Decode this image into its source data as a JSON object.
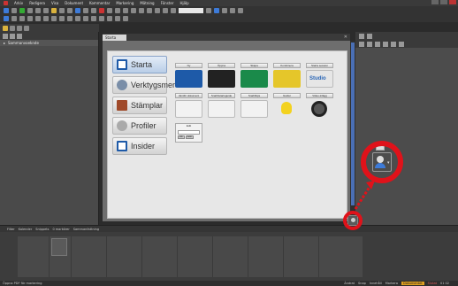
{
  "menubar": {
    "items": [
      "Arkiv",
      "Redigera",
      "Visa",
      "Dokument",
      "Kommentar",
      "Markering",
      "Mätning",
      "Fönster",
      "Hjälp"
    ]
  },
  "left_panel": {
    "title": "Sammanvoeknde"
  },
  "document_tab": {
    "label": "Starta",
    "close": "✕"
  },
  "start_menu": {
    "items": [
      {
        "label": "Starta",
        "icon": "start-icon",
        "active": true
      },
      {
        "label": "Verktygsmer",
        "icon": "tools-icon",
        "active": false
      },
      {
        "label": "Stämplar",
        "icon": "stamp-icon",
        "active": false
      },
      {
        "label": "Profiler",
        "icon": "profile-icon",
        "active": false
      },
      {
        "label": "Insider",
        "icon": "insider-icon",
        "active": false
      }
    ]
  },
  "tiles": [
    {
      "label": "Ny",
      "style": "blue"
    },
    {
      "label": "Öppna",
      "style": "dark"
    },
    {
      "label": "Skapa",
      "style": "green"
    },
    {
      "label": "Kombinera",
      "style": "yellow"
    },
    {
      "label": "Starta session",
      "style": "studio",
      "text": "Studio"
    },
    {
      "label": "Jämför dokument",
      "style": "paper"
    },
    {
      "label": "Snabbstartsguide",
      "style": "paper"
    },
    {
      "label": "Snabbtips",
      "style": "paper"
    },
    {
      "label": "Guider",
      "style": "bulb"
    },
    {
      "label": "Video-inlägg",
      "style": "reel"
    }
  ],
  "edit_box": {
    "label": "Edit",
    "placeholder": "",
    "buttons": [
      "OK",
      "Avbr"
    ]
  },
  "bottom_toolbar": {
    "items": [
      "Filter",
      "Kalender",
      "Snippets",
      "0 markörer",
      "Sammanfattning"
    ]
  },
  "statusbar": {
    "left": "Öppna PDF för markering",
    "right": [
      "Ändrat",
      "Snap",
      "Innehåll",
      "Markera"
    ],
    "highlight": "Dokumentet",
    "highlight2": "Slutat",
    "page": "01 02"
  }
}
